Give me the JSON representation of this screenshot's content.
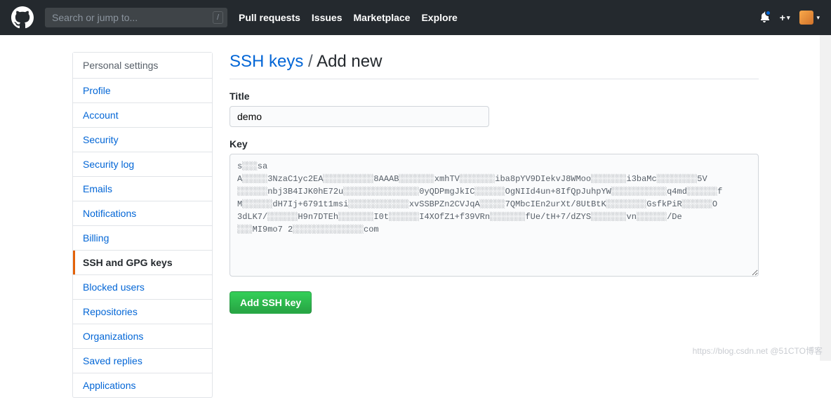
{
  "topnav": {
    "search_placeholder": "Search or jump to...",
    "links": [
      "Pull requests",
      "Issues",
      "Marketplace",
      "Explore"
    ]
  },
  "sidebar": {
    "title": "Personal settings",
    "items": [
      {
        "label": "Profile",
        "active": false
      },
      {
        "label": "Account",
        "active": false
      },
      {
        "label": "Security",
        "active": false
      },
      {
        "label": "Security log",
        "active": false
      },
      {
        "label": "Emails",
        "active": false
      },
      {
        "label": "Notifications",
        "active": false
      },
      {
        "label": "Billing",
        "active": false
      },
      {
        "label": "SSH and GPG keys",
        "active": true
      },
      {
        "label": "Blocked users",
        "active": false
      },
      {
        "label": "Repositories",
        "active": false
      },
      {
        "label": "Organizations",
        "active": false
      },
      {
        "label": "Saved replies",
        "active": false
      },
      {
        "label": "Applications",
        "active": false
      }
    ]
  },
  "heading": {
    "link": "SSH keys",
    "sep": "/",
    "current": "Add new"
  },
  "form": {
    "title_label": "Title",
    "title_value": "demo",
    "key_label": "Key",
    "key_value": "s░░░sa\nA░░░░░3NzaC1yc2EA░░░░░░░░░░8AAAB░░░░░░░xmhTV░░░░░░░iba8pYV9DIekvJ8WMoo░░░░░░░i3baMc░░░░░░░░5V\n░░░░░░nbj3B4IJK0hE72u░░░░░░░░░░░░░░░0yQDPmgJkIC░░░░░░OgNIId4un+8IfQpJuhpYW░░░░░░░░░░░q4md░░░░░░f\nM░░░░░░dH7Ij+6791t1msi░░░░░░░░░░░░xvSSBPZn2CVJqA░░░░░7QMbcIEn2urXt/8UtBtK░░░░░░░░GsfkPiR░░░░░░O\n3dLK7/░░░░░░H9n7DTEh░░░░░░░I0t░░░░░░I4XOfZ1+f39VRn░░░░░░░fUe/tH+7/dZYS░░░░░░░vn░░░░░░/De\n░░░MI9mo7 2░░░░░░░░░░░░░░com",
    "submit_label": "Add SSH key"
  },
  "watermark": "https://blog.csdn.net @51CTO博客"
}
